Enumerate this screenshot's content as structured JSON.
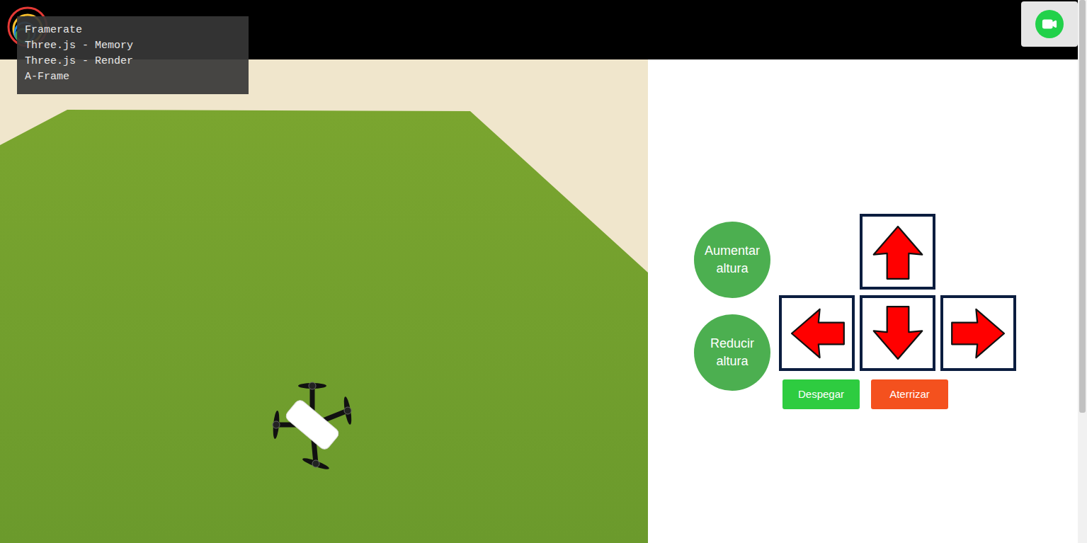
{
  "stats_panel": {
    "lines": [
      "Framerate",
      "Three.js - Memory",
      "Three.js - Render",
      "A-Frame"
    ]
  },
  "controls": {
    "altitude_buttons": [
      {
        "label": "Aumentar altura"
      },
      {
        "label": "Reducir altura"
      }
    ],
    "arrows": [
      {
        "kind": "up"
      },
      {
        "kind": "left"
      },
      {
        "kind": "down"
      },
      {
        "kind": "right"
      }
    ],
    "action_buttons": [
      {
        "label": "Despegar",
        "color": "#2ecc40"
      },
      {
        "label": "Aterrizar",
        "color": "#f4511e"
      }
    ]
  },
  "scrollbar": {
    "level": 0.76
  }
}
